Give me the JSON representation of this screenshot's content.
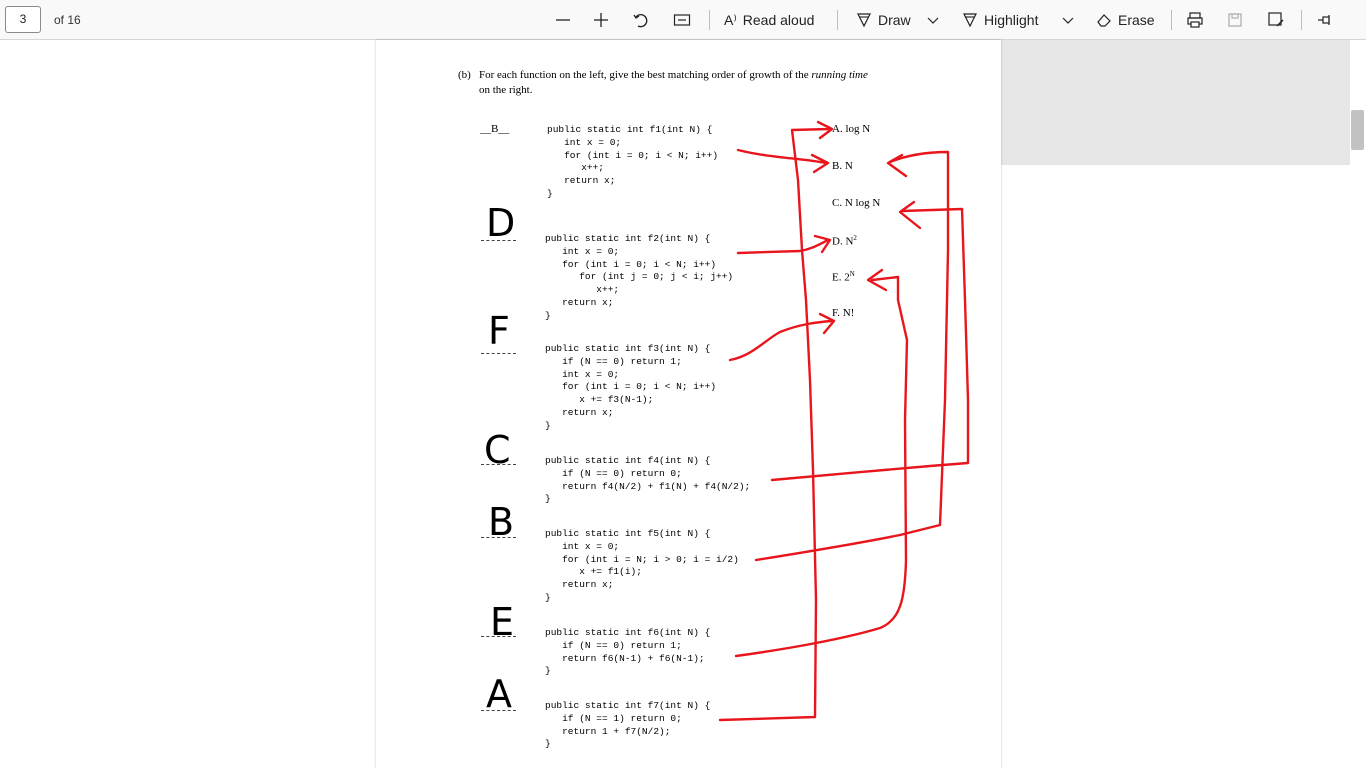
{
  "toolbar": {
    "page_number": "3",
    "page_count_label": "of 16",
    "read_aloud_label": "Read aloud",
    "draw_label": "Draw",
    "highlight_label": "Highlight",
    "erase_label": "Erase"
  },
  "document": {
    "question_marker": "(b)",
    "question_text_1": "For each function on the left, give the best matching order of growth of the ",
    "question_text_italic": "running time",
    "question_text_2": "on the right.",
    "printed_answer_f1": "__B__",
    "functions": [
      [
        "public static int f1(int N) {",
        "   int x = 0;",
        "   for (int i = 0; i < N; i++)",
        "      x++;",
        "   return x;",
        "}"
      ],
      [
        "public static int f2(int N) {",
        "   int x = 0;",
        "   for (int i = 0; i < N; i++)",
        "      for (int j = 0; j < i; j++)",
        "         x++;",
        "   return x;",
        "}"
      ],
      [
        "public static int f3(int N) {",
        "   if (N == 0) return 1;",
        "   int x = 0;",
        "   for (int i = 0; i < N; i++)",
        "      x += f3(N-1);",
        "   return x;",
        "}"
      ],
      [
        "public static int f4(int N) {",
        "   if (N == 0) return 0;",
        "   return f4(N/2) + f1(N) + f4(N/2);",
        "}"
      ],
      [
        "public static int f5(int N) {",
        "   int x = 0;",
        "   for (int i = N; i > 0; i = i/2)",
        "      x += f1(i);",
        "   return x;",
        "}"
      ],
      [
        "public static int f6(int N) {",
        "   if (N == 0) return 1;",
        "   return f6(N-1) + f6(N-1);",
        "}"
      ],
      [
        "public static int f7(int N) {",
        "   if (N == 1) return 0;",
        "   return 1 + f7(N/2);",
        "}"
      ]
    ],
    "options": {
      "a": "A. log N",
      "b": "B. N",
      "c": "C. N log N",
      "d": "D. N",
      "d_sup": "2",
      "e": "E. 2",
      "e_sup": "N",
      "f": "F. N!"
    },
    "handwritten_answers": [
      "D",
      "F",
      "C",
      "B",
      "E",
      "A"
    ]
  },
  "colors": {
    "ink": "#e8161c",
    "accent": "#1a1a1a"
  }
}
